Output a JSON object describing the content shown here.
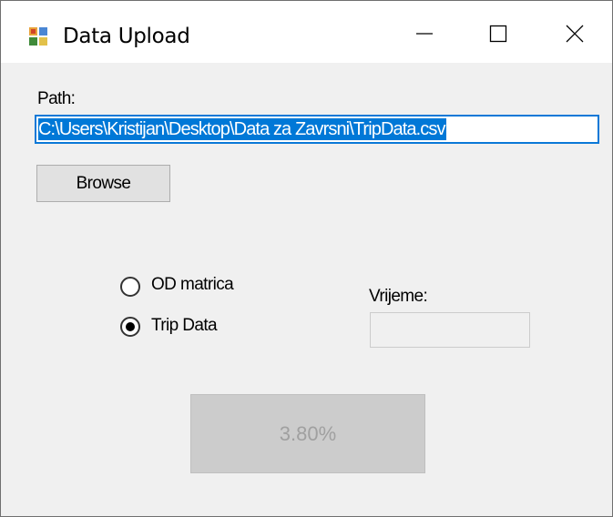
{
  "window": {
    "title": "Data Upload",
    "icon": "data-upload-app-icon",
    "controls": {
      "minimize_icon": "minimize-icon",
      "maximize_icon": "maximize-icon",
      "close_icon": "close-icon"
    }
  },
  "form": {
    "path_label": "Path:",
    "path_value": "C:\\Users\\Kristijan\\Desktop\\Data za Zavrsni\\TripData.csv",
    "browse_label": "Browse",
    "radios": [
      {
        "label": "OD matrica",
        "checked": false
      },
      {
        "label": "Trip Data",
        "checked": true
      }
    ],
    "vrijeme_label": "Vrijeme:",
    "vrijeme_value": "",
    "progress_text": "3.80%"
  },
  "colors": {
    "selection": "#0078d7",
    "focus_border": "#0a78d7",
    "window_bg": "#f0f0f0",
    "disabled_button_bg": "#cccccc",
    "disabled_text": "#a0a0a0"
  }
}
